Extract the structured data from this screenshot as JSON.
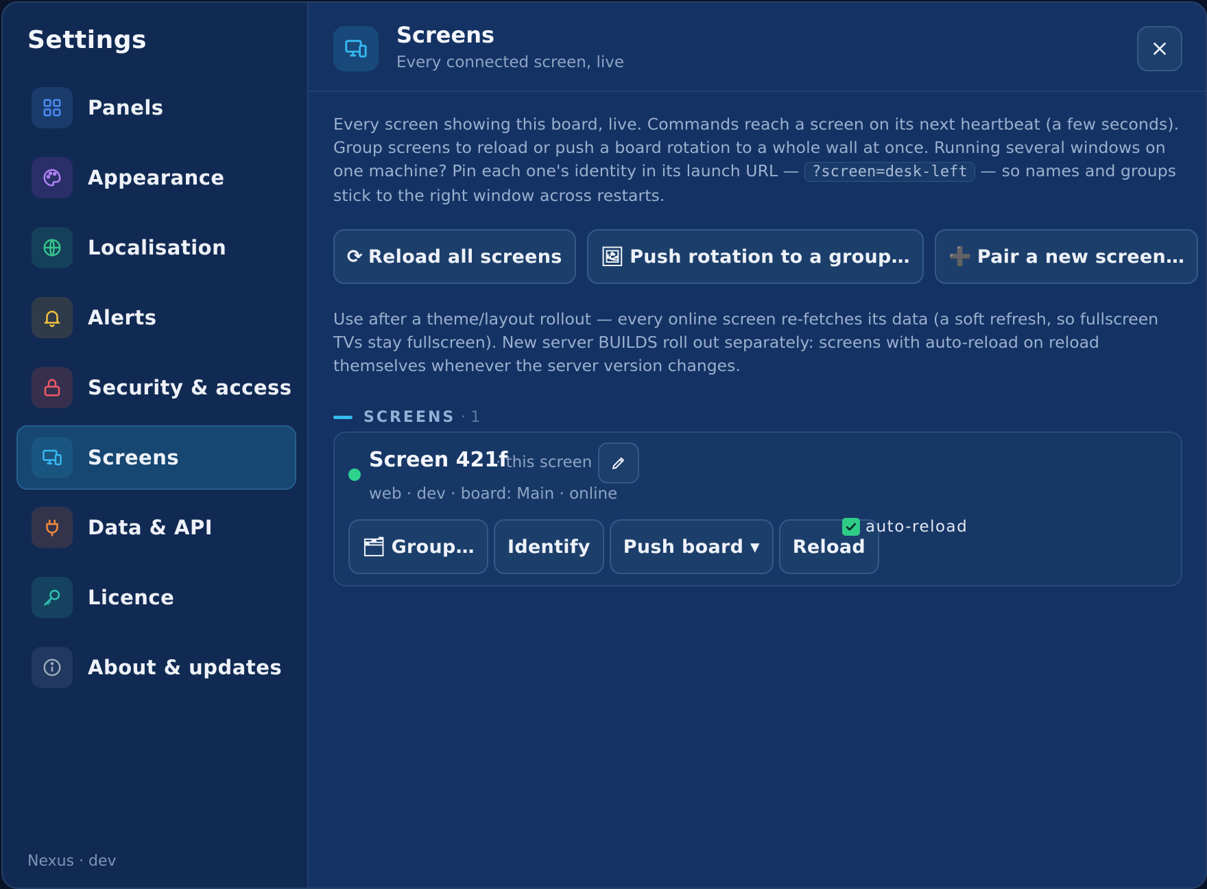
{
  "sidebar": {
    "title": "Settings",
    "items": [
      {
        "label": "Panels",
        "icon": "grid-icon",
        "color": "#4c8df5",
        "bg": "#1a3b6c",
        "active": false
      },
      {
        "label": "Appearance",
        "icon": "palette-icon",
        "color": "#b083f5",
        "bg": "#2a2f6a",
        "active": false
      },
      {
        "label": "Localisation",
        "icon": "globe-icon",
        "color": "#39c58a",
        "bg": "#14405a",
        "active": false
      },
      {
        "label": "Alerts",
        "icon": "bell-icon",
        "color": "#f4c33d",
        "bg": "#303b4a",
        "active": false
      },
      {
        "label": "Security & access",
        "icon": "lock-icon",
        "color": "#f05a63",
        "bg": "#36304e",
        "active": false
      },
      {
        "label": "Screens",
        "icon": "monitor-icon",
        "color": "#36b9f2",
        "bg": "#1a557f",
        "active": true
      },
      {
        "label": "Data & API",
        "icon": "plug-icon",
        "color": "#f58b3c",
        "bg": "#33344c",
        "active": false
      },
      {
        "label": "Licence",
        "icon": "key-icon",
        "color": "#30bfae",
        "bg": "#15435f",
        "active": false
      },
      {
        "label": "About & updates",
        "icon": "info-icon",
        "color": "#9aa8bd",
        "bg": "#213860",
        "active": false
      }
    ],
    "footer": "Nexus · dev"
  },
  "header": {
    "icon": "monitor-icon",
    "title": "Screens",
    "subtitle": "Every connected screen, live",
    "close_icon": "close-icon"
  },
  "intro": {
    "text_before": "Every screen showing this board, live. Commands reach a screen on its next heartbeat (a few seconds). Group screens to reload or push a board rotation to a whole wall at once. Running several windows on one machine? Pin each one's identity in its launch URL — ",
    "code": "?screen=desk-left",
    "text_after": " — so names and groups stick to the right window across restarts."
  },
  "actions": {
    "reload_all": {
      "glyph": "⟳",
      "label": "Reload all screens"
    },
    "push_rotation": {
      "glyph": "🖼",
      "label": "Push rotation to a group…"
    },
    "pair_new": {
      "glyph": "➕",
      "label": "Pair a new screen…"
    }
  },
  "note": "Use after a theme/layout rollout — every online screen re-fetches its data (a soft refresh, so fullscreen TVs stay fullscreen). New server BUILDS roll out separately: screens with auto-reload on reload themselves whenever the server version changes.",
  "screens_section": {
    "heading": "SCREENS",
    "count": "· 1"
  },
  "screen": {
    "name": "Screen 421f",
    "tag": "· this screen",
    "meta": "web · dev · board: Main · online",
    "status_color": "#2ed28f",
    "buttons": {
      "group": {
        "glyph": "🗂",
        "label": "Group…"
      },
      "identify": "Identify",
      "push_board": "Push board ▾",
      "reload": "Reload"
    },
    "auto_reload": {
      "label": "auto-reload",
      "checked": true
    }
  }
}
